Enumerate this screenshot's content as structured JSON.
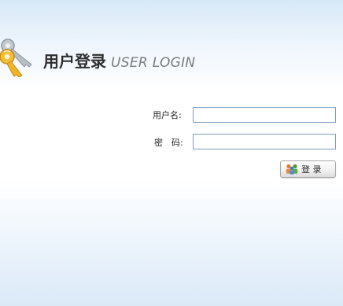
{
  "header": {
    "title_cn": "用户登录",
    "title_en": "USER LOGIN",
    "logo_icon": "key-icon"
  },
  "form": {
    "username_label": "用户名:",
    "password_label": "密　码:",
    "username_value": "",
    "password_value": "",
    "submit_label": "登 录",
    "submit_icon": "users-icon"
  },
  "colors": {
    "input_border": "#7f9db9",
    "title_cn": "#2e2e2e",
    "title_en": "#7b7b7b",
    "key_gold": "#f0b428",
    "key_silver": "#b8bec6"
  }
}
